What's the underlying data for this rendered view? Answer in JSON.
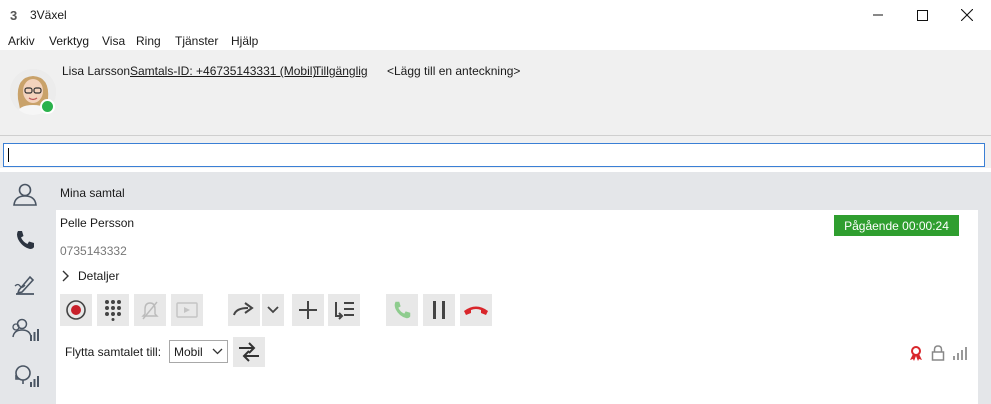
{
  "app": {
    "title": "3Växel"
  },
  "menu": [
    "Arkiv",
    "Verktyg",
    "Visa",
    "Ring",
    "Tjänster",
    "Hjälp"
  ],
  "user": {
    "name": "Lisa Larsson",
    "caller_id": "Samtals-ID: +46735143331 (Mobil)",
    "availability": "Tillgänglig",
    "note": "<Lägg till en anteckning>",
    "status_color": "#2bb24c"
  },
  "search": {
    "value": "",
    "placeholder": ""
  },
  "nav": [
    "person-icon",
    "phone-icon",
    "signature-icon",
    "group-icon",
    "headset-icon"
  ],
  "section": {
    "title": "Mina samtal"
  },
  "call": {
    "name": "Pelle Persson",
    "number": "0735143332",
    "details_label": "Detaljer",
    "status": "Pågående 00:00:24",
    "status_color": "#2f9e2f"
  },
  "transfer": {
    "label": "Flytta samtalet till:",
    "selected": "Mobil"
  },
  "colors": {
    "hangup": "#d9262b",
    "record": "#c8202a",
    "answer": "#8ecc8e",
    "input_focus": "#3a7fd5"
  }
}
